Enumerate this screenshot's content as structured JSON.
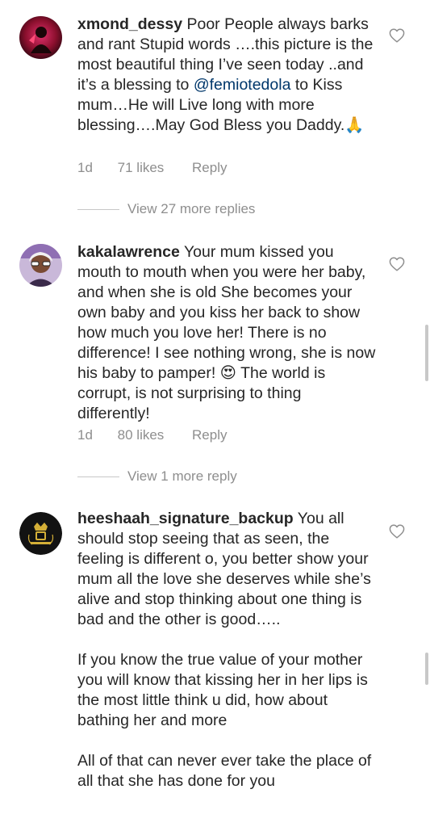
{
  "comments": [
    {
      "username": "xmond_dessy",
      "text_before_mention": "Poor People always barks and rant Stupid words ….this picture is the most beautiful thing I’ve seen today ..and it’s a blessing to ",
      "mention": "@femiotedola",
      "text_after_mention": " to Kiss mum…He will Live long with more blessing….May God Bless you Daddy.🙏",
      "age": "1d",
      "likes": "71 likes",
      "reply_label": "Reply",
      "view_more": "View 27 more replies"
    },
    {
      "username": "kakalawrence",
      "text": "Your mum kissed you mouth to mouth when you were her baby, and when she is old She becomes your own baby and you kiss her back to show how much you love her! There is no difference! I see nothing wrong, she is now his baby to pamper! 😍 The world is corrupt, is not surprising to thing differently!",
      "age": "1d",
      "likes": "80 likes",
      "reply_label": "Reply",
      "view_more": "View 1 more reply"
    },
    {
      "username": "heeshaah_signature_backup",
      "text": "You all should stop seeing that as seen, the feeling is different o, you better show your mum all the love she deserves while she’s alive and stop thinking about one thing is bad and the other is good…..\n\nIf you know the true value of your mother you will know that kissing her in her lips is the most little think u did, how about bathing her and more\n\nAll of that can never ever take the place of all that she has done for you"
    }
  ],
  "icons": {
    "like": "heart-outline-icon"
  },
  "colors": {
    "text": "#262626",
    "secondary": "#8e8e8e",
    "mention": "#00376b"
  }
}
